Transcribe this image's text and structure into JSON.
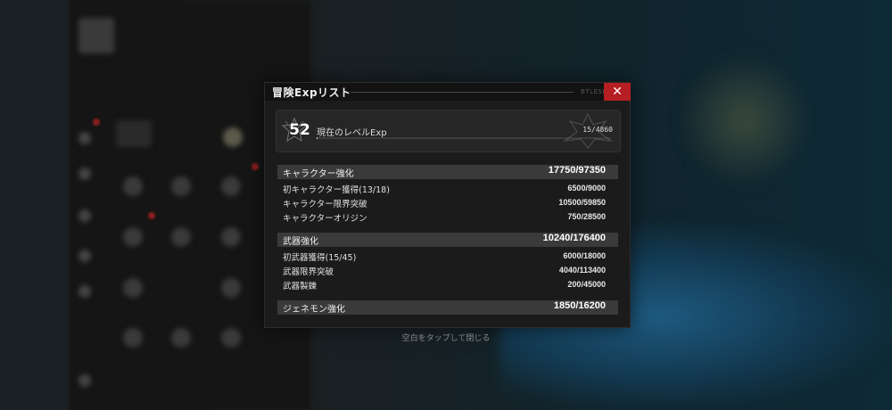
{
  "dialog": {
    "title": "冒険Expリスト",
    "title_tag": "BTLESK",
    "close_label": "✕"
  },
  "level": {
    "number": "52",
    "label": "現在のレベルExp",
    "current": "15",
    "max": "4860",
    "value_text": "15/4860",
    "progress_fraction": 0.003
  },
  "sections": [
    {
      "label": "キャラクター強化",
      "current": "17750",
      "max": "97350",
      "rows": [
        {
          "label": "初キャラクター獲得(13/18)",
          "current": "6500",
          "max": "9000"
        },
        {
          "label": "キャラクター限界突破",
          "current": "10500",
          "max": "59850"
        },
        {
          "label": "キャラクターオリジン",
          "current": "750",
          "max": "28500"
        }
      ]
    },
    {
      "label": "武器強化",
      "current": "10240",
      "max": "176400",
      "rows": [
        {
          "label": "初武器獲得(15/45)",
          "current": "6000",
          "max": "18000"
        },
        {
          "label": "武器限界突破",
          "current": "4040",
          "max": "113400"
        },
        {
          "label": "武器製錬",
          "current": "200",
          "max": "45000"
        }
      ]
    },
    {
      "label": "ジェネモン強化",
      "current": "1850",
      "max": "16200",
      "rows": []
    }
  ],
  "hint": "空白をタップして閉じる",
  "colors": {
    "close_button": "#b51e22",
    "dialog_bg": "#1b1b1b",
    "section_header_bg": "#3a3a3a"
  }
}
